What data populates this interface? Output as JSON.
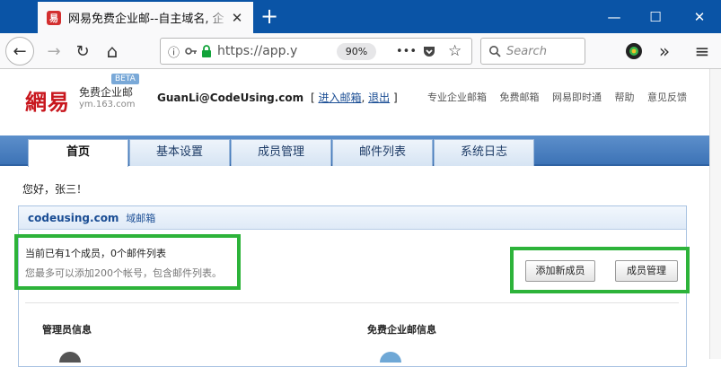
{
  "browser": {
    "tab_title": "网易免费企业邮--自主域名, 企",
    "tab_favicon": "易",
    "tab_close": "✕",
    "newtab": "+",
    "window": {
      "minimize": "—",
      "maximize": "☐",
      "close": "✕"
    },
    "nav": {
      "back": "←",
      "forward": "→",
      "reload": "↻",
      "home": "⌂"
    },
    "url": "https://app.y",
    "zoom": "90%",
    "page_actions": "•••",
    "search_placeholder": "Search",
    "overflow": "»",
    "menu": "≡"
  },
  "header": {
    "logo_cn": "網易",
    "logo_sub": "免费企业邮",
    "logo_domain": "ym.163.com",
    "logo_beta": "BETA",
    "user_email": "GuanLi@CodeUsing.com",
    "bracket_open": "[",
    "enter_mailbox": "进入邮箱",
    "comma": ",",
    "logout": "退出",
    "bracket_close": "]",
    "links": [
      "专业企业邮箱",
      "免费邮箱",
      "网易即时通",
      "帮助",
      "意见反馈"
    ]
  },
  "tabs": [
    "首页",
    "基本设置",
    "成员管理",
    "邮件列表",
    "系统日志"
  ],
  "greeting": "您好，张三！",
  "panel": {
    "domain": "codeusing.com",
    "suffix": "域邮箱",
    "info_line1": "当前已有1个成员，0个邮件列表",
    "info_line2": "您最多可以添加200个帐号，包含邮件列表。",
    "add_member": "添加新成员",
    "manage_members": "成员管理",
    "admin_info": "管理员信息",
    "free_info": "免费企业邮信息"
  },
  "colors": {
    "accent": "#2db33a",
    "brand": "#c8161d",
    "tabbar": "#3d73b6"
  }
}
